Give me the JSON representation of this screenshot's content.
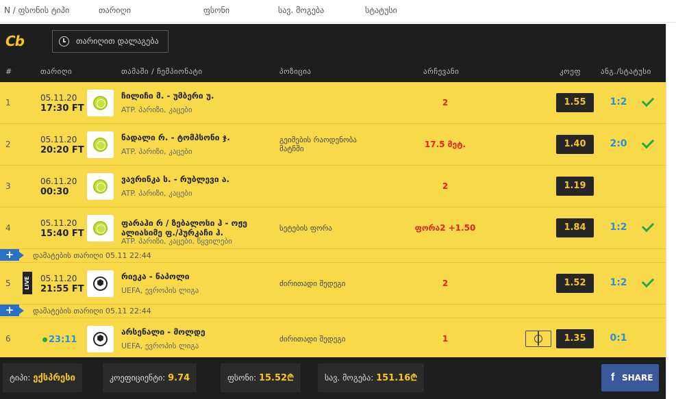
{
  "topbar": {
    "col_num_type": "N / ფსონის ტიპი",
    "col_date": "თარიღი",
    "col_stake": "ფსონი",
    "col_win": "სავ. მოგება",
    "col_status": "სტატუსი"
  },
  "header": {
    "logo": "Cb",
    "date_filter": "თარიღით დალაგება"
  },
  "columns": {
    "num": "#",
    "date": "თარიღი",
    "event": "თამაში / ჩემპიონატი",
    "market": "პოზიცია",
    "pick": "არჩევანი",
    "odds": "კოეფ",
    "result": "ანგ./სტატუსი"
  },
  "rows": [
    {
      "num": "1",
      "date": "05.11.20",
      "time": "17:30 FT",
      "sport": "tennis-icon",
      "teams": "ჩილიჩი მ. - უმბერი უ.",
      "league": "ATP. პარიზი, კაცები",
      "market": "",
      "pick": "2",
      "odds": "1.55",
      "score": "1:2",
      "won": true
    },
    {
      "num": "2",
      "date": "05.11.20",
      "time": "20:20 FT",
      "sport": "tennis-icon",
      "teams": "ნადალი რ. - ტომპსონი ჯ.",
      "league": "ATP. პარიზი, კაცები",
      "market": "გეიმების რაოდენობა მატჩში",
      "pick": "17.5 მეტ.",
      "odds": "1.40",
      "score": "2:0",
      "won": true
    },
    {
      "num": "3",
      "date": "06.11.20",
      "time": "00:30",
      "sport": "tennis-icon",
      "teams": "ვავრინკა ს. - რუბლევი ა.",
      "league": "ATP. პარიზი, კაცები",
      "market": "",
      "pick": "2",
      "odds": "1.19",
      "score": "",
      "won": false
    },
    {
      "num": "4",
      "date": "05.11.20",
      "time": "15:40 FT",
      "sport": "tennis-icon",
      "teams": "ფარაჰი რ / ზებალოსი ჰ - ოჟე ალიასიმე ფ./ჰურკაჩი ჰ.",
      "league": "ATP. პარიზი, კაცები. წყვილები",
      "market": "სეტების ფორა",
      "pick": "ფორა2 +1.50",
      "odds": "1.84",
      "score": "1:2",
      "won": true
    },
    {
      "info": "დამატების თარიღი 05.11 22:44"
    },
    {
      "num": "5",
      "date": "05.11.20",
      "time": "21:55 FT",
      "sport": "football-icon",
      "live": "LIVE",
      "teams": "რიეკა - ნაპოლი",
      "league": "UEFA, ევროპის ლიგა",
      "market": "ძირითადი შედეგი",
      "pick": "2",
      "odds": "1.52",
      "score": "1:2",
      "won": true
    },
    {
      "info": "დამატების თარიღი 05.11 22:44"
    },
    {
      "num": "6",
      "date": "",
      "time": "23:11",
      "sport": "football-icon",
      "inplay": true,
      "teams": "არსენალი - მოლდე",
      "league": "UEFA, ევროპის ლიგა",
      "market": "ძირითადი შედეგი",
      "pick": "1",
      "odds": "1.35",
      "score": "0:1",
      "won": false
    }
  ],
  "footer": {
    "type_label": "ტიპი:",
    "type_value": "ექსპრესი",
    "coef_label": "კოეფიციენტი:",
    "coef_value": "9.74",
    "stake_label": "ფსონი:",
    "stake_value": "15.52₾",
    "win_label": "სავ. მოგება:",
    "win_value": "151.16₾",
    "share_label": "SHARE"
  },
  "colors": {
    "row_bg": "#f7d94a",
    "panel_bg": "#1e1e1e",
    "accent": "#f7c520",
    "red": "#e0231b",
    "blue": "#2a8fd6",
    "green": "#27a844",
    "facebook": "#3b5998"
  }
}
